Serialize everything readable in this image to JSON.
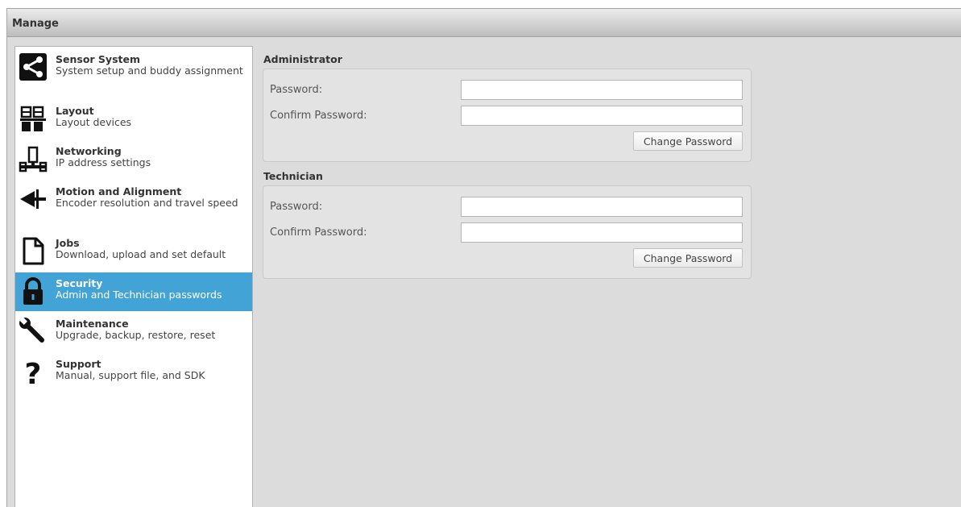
{
  "window": {
    "title": "Manage"
  },
  "sidebar": {
    "items": [
      {
        "title": "Sensor System",
        "subtitle": "System setup and buddy assignment",
        "icon": "share-icon"
      },
      {
        "title": "Layout",
        "subtitle": "Layout devices",
        "icon": "layout-icon"
      },
      {
        "title": "Networking",
        "subtitle": "IP address settings",
        "icon": "network-icon"
      },
      {
        "title": "Motion and Alignment",
        "subtitle": "Encoder resolution and travel speed",
        "icon": "motion-arrow-icon"
      },
      {
        "title": "Jobs",
        "subtitle": "Download, upload and set default",
        "icon": "document-icon"
      },
      {
        "title": "Security",
        "subtitle": "Admin and Technician passwords",
        "icon": "lock-icon",
        "active": true
      },
      {
        "title": "Maintenance",
        "subtitle": "Upgrade, backup, restore, reset",
        "icon": "wrench-icon"
      },
      {
        "title": "Support",
        "subtitle": "Manual, support file, and SDK",
        "icon": "question-icon"
      }
    ]
  },
  "administrator": {
    "heading": "Administrator",
    "password_label": "Password:",
    "confirm_label": "Confirm Password:",
    "password_value": "",
    "confirm_value": "",
    "button_label": "Change Password"
  },
  "technician": {
    "heading": "Technician",
    "password_label": "Password:",
    "confirm_label": "Confirm Password:",
    "password_value": "",
    "confirm_value": "",
    "button_label": "Change Password"
  },
  "colors": {
    "active_item_bg": "#42a4d6",
    "panel_bg": "#dcdcdc"
  }
}
